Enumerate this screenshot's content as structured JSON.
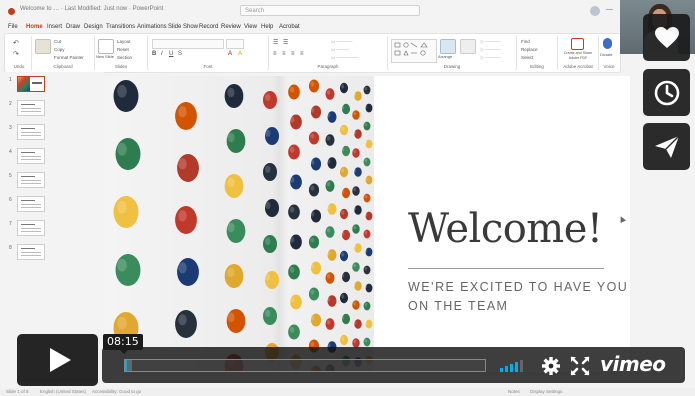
{
  "app": {
    "title": "Welcome to … · Last Modified: Just now · PowerPoint",
    "search_placeholder": "Search",
    "brand_color": "#c43e1c"
  },
  "tabs": [
    "File",
    "Home",
    "Insert",
    "Draw",
    "Design",
    "Transitions",
    "Animations",
    "Slide Show",
    "Record",
    "Review",
    "View",
    "Help",
    "Acrobat"
  ],
  "active_tab": "Home",
  "ribbon": {
    "groups": [
      "Undo",
      "Clipboard",
      "Slides",
      "Font",
      "Paragraph",
      "Drawing",
      "Editing",
      "Adobe Acrobat",
      "Voice",
      "Designer"
    ],
    "clipboard_items": [
      "Cut",
      "Copy",
      "Format Painter"
    ],
    "slides_items": [
      "New Slide",
      "Layout",
      "Reset",
      "Section"
    ],
    "drawing_items": [
      "Shapes",
      "Arrange",
      "Quick Styles"
    ],
    "editing_items": [
      "Find",
      "Replace",
      "Select"
    ],
    "acrobat_label": "Create and Share Adobe PDF",
    "voice_label": "Dictate",
    "designer_label": "Designer"
  },
  "slide_panel": {
    "numbers": [
      "1",
      "2",
      "3",
      "4",
      "5",
      "6",
      "7",
      "8"
    ],
    "active_index": 0
  },
  "slide": {
    "title": "Welcome!",
    "subtitle_line1": "WE’RE EXCITED TO HAVE YOU",
    "subtitle_line2": "ON THE TEAM"
  },
  "statusbar": {
    "slide_counter": "Slide 1 of 8",
    "language": "English (United States)",
    "accessibility": "Accessibility: Good to go",
    "notes": "Notes",
    "display_settings": "Display Settings"
  },
  "player": {
    "timestamp": "08:15",
    "progress_fraction": 0.005,
    "buffered_fraction": 0.02,
    "logo": "vimeo",
    "accent_color": "#00adef",
    "side_buttons": [
      "heart-icon",
      "clock-icon",
      "send-icon"
    ],
    "volume_level": 0.8
  }
}
